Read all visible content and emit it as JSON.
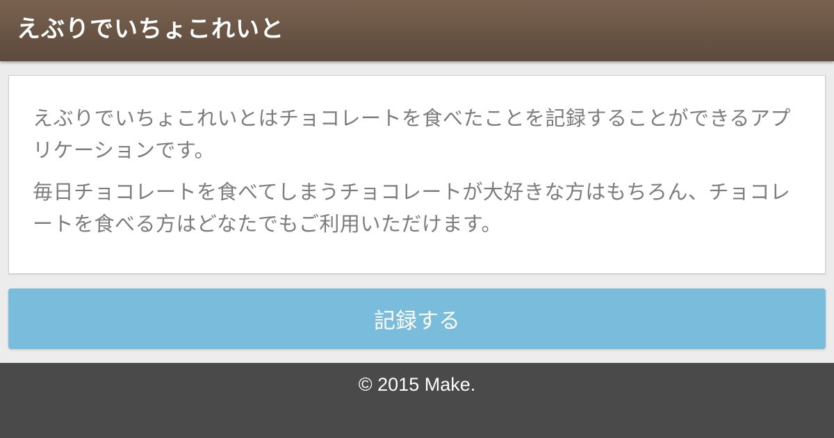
{
  "header": {
    "title": "えぶりでいちょこれいと"
  },
  "intro": {
    "paragraphs": [
      "えぶりでいちょこれいとはチョコレートを食べたことを記録することができるアプリケーションです。",
      "毎日チョコレートを食べてしまうチョコレートが大好きな方はもちろん、チョコレートを食べる方はどなたでもご利用いただけます。"
    ]
  },
  "actions": {
    "record_label": "記録する"
  },
  "footer": {
    "copyright": "© 2015 Make."
  },
  "colors": {
    "header_top": "#7a6250",
    "header_bottom": "#5c4a3c",
    "button": "#7abcdb",
    "footer": "#4a4a4a",
    "text": "#7c7c7c"
  }
}
